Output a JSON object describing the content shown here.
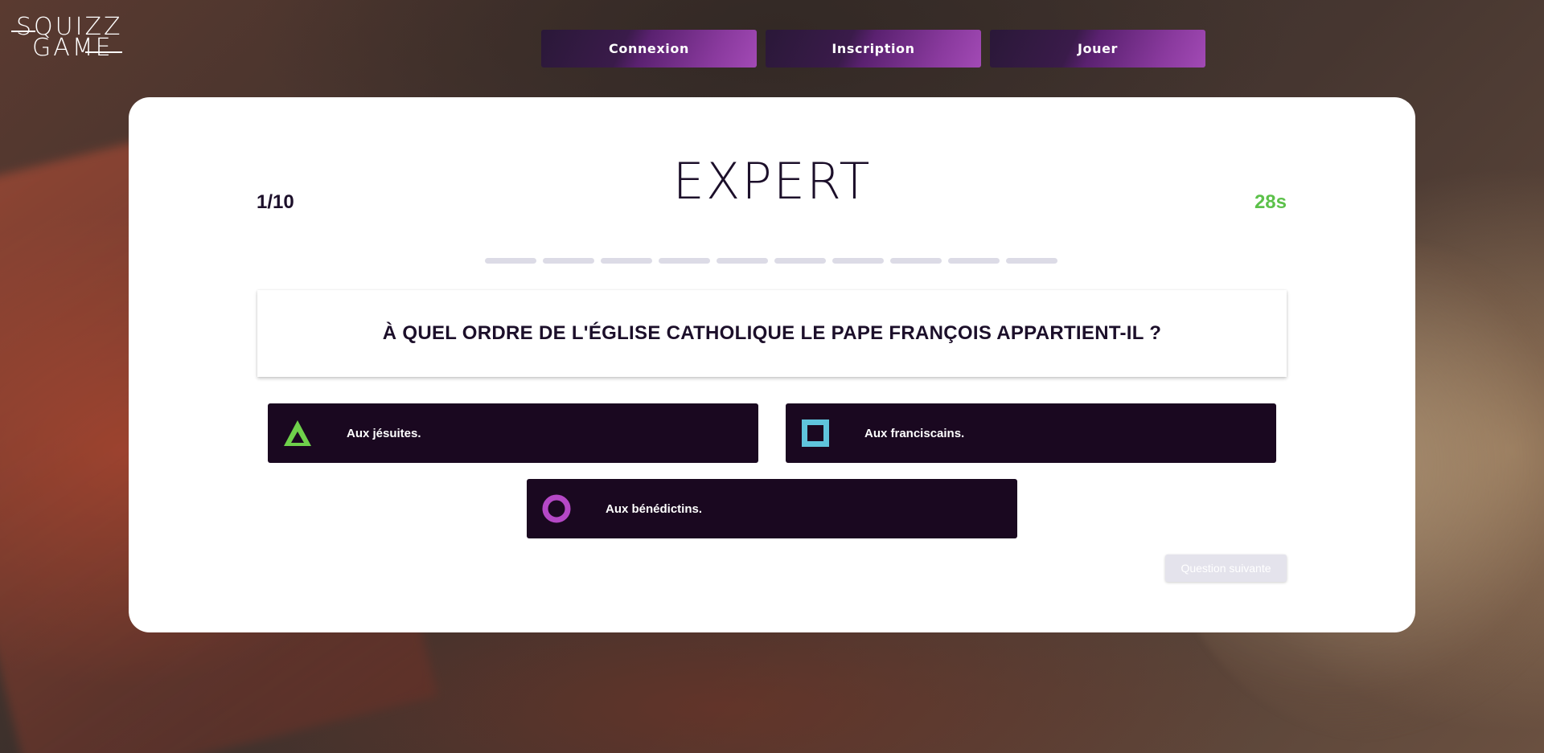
{
  "logo": {
    "line1": "SQUIZZ",
    "line2": "GAME"
  },
  "nav": [
    {
      "label": "Connexion"
    },
    {
      "label": "Inscription"
    },
    {
      "label": "Jouer"
    }
  ],
  "quiz": {
    "level": "EXPERT",
    "counter": "1/10",
    "timer": "28s",
    "progress_total": 10,
    "progress_done": 0,
    "question": "À QUEL ORDRE DE L'ÉGLISE CATHOLIQUE LE PAPE FRANÇOIS APPARTIENT-IL ?",
    "answers": [
      {
        "label": "Aux jésuites.",
        "icon": "triangle-icon",
        "color": "#6fd14b"
      },
      {
        "label": "Aux franciscains.",
        "icon": "square-icon",
        "color": "#5fc4dc"
      },
      {
        "label": "Aux bénédictins.",
        "icon": "circle-icon",
        "color": "#b548c6"
      }
    ],
    "next_label": "Question suivante"
  },
  "colors": {
    "accent": "#a24ab5",
    "timer": "#5cc14a",
    "answer_bg": "#1a0820",
    "text_dark": "#1c0f2a"
  }
}
